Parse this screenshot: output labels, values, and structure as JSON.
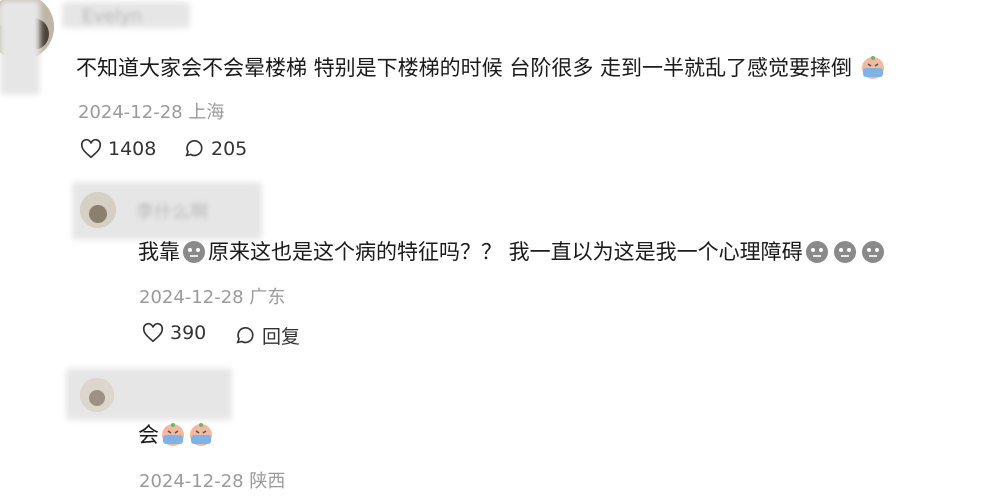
{
  "comments": [
    {
      "username": "Evelyn",
      "text": "不知道大家会不会晕楼梯 特别是下楼梯的时候 台阶很多 走到一半就乱了感觉要摔倒",
      "emoji_after": [
        "crying-emoji"
      ],
      "date": "2024-12-28",
      "location": "上海",
      "likes": "1408",
      "replies": "205"
    },
    {
      "username": "李什么啊",
      "text_a": "我靠",
      "text_b": "原来这也是这个病的特征吗？？ 我一直以为这是我一个心理障碍",
      "date": "2024-12-28",
      "location": "广东",
      "likes": "390",
      "reply_label": "回复"
    },
    {
      "text": "会",
      "emoji_after": [
        "crying-emoji",
        "crying-emoji"
      ],
      "date": "2024-12-28",
      "location": "陕西"
    }
  ]
}
